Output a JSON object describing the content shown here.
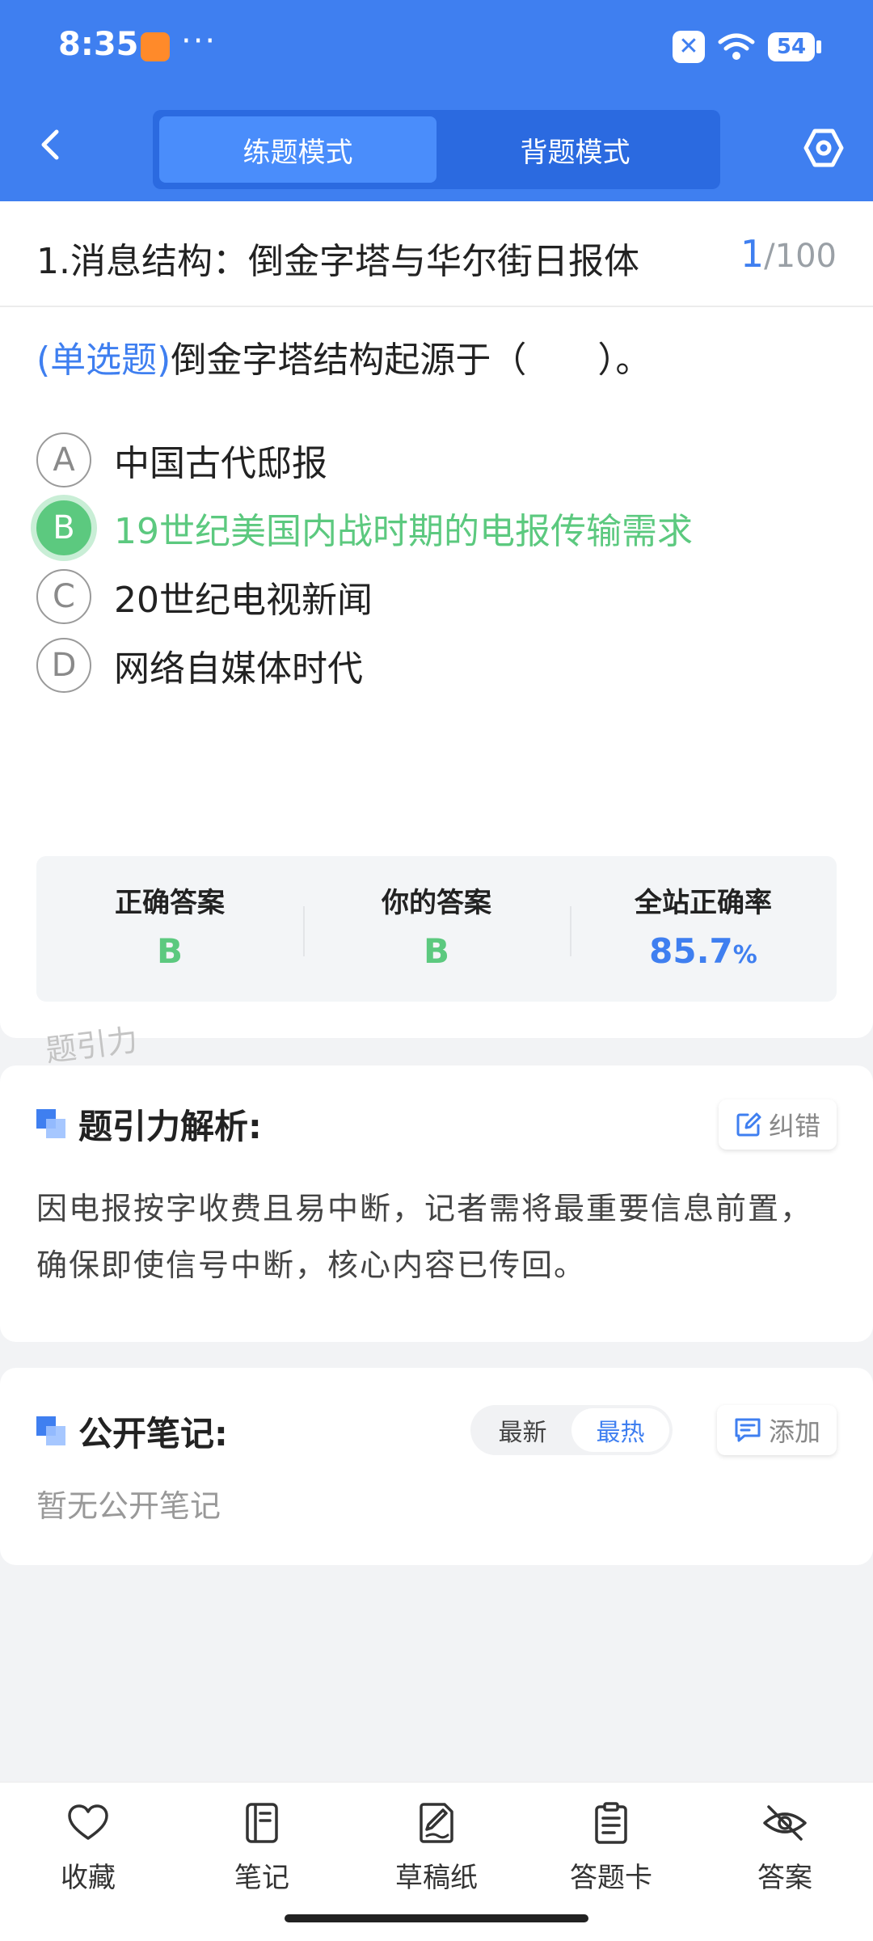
{
  "status_bar": {
    "time": "8:35",
    "more": "···",
    "battery": "54"
  },
  "nav": {
    "tabs": [
      {
        "label": "练题模式",
        "active": true
      },
      {
        "label": "背题模式",
        "active": false
      }
    ],
    "icons": {
      "back": "chevron-left-icon",
      "settings": "hexagon-settings-icon"
    }
  },
  "question": {
    "section_title": "1.消息结构：倒金字塔与华尔街日报体",
    "counter": {
      "current": "1",
      "total": "/100"
    },
    "type_label": "(单选题)",
    "stem": "倒金字塔结构起源于（　　）。",
    "options": [
      {
        "letter": "A",
        "text": "中国古代邸报",
        "state": "normal"
      },
      {
        "letter": "B",
        "text": "19世纪美国内战时期的电报传输需求",
        "state": "correct"
      },
      {
        "letter": "C",
        "text": "20世纪电视新闻",
        "state": "normal"
      },
      {
        "letter": "D",
        "text": "网络自媒体时代",
        "state": "normal"
      }
    ],
    "stats": [
      {
        "label": "正确答案",
        "value": "B"
      },
      {
        "label": "你的答案",
        "value": "B"
      },
      {
        "label": "全站正确率",
        "value": "85.7",
        "unit": "%"
      }
    ]
  },
  "watermark": "题引力",
  "analysis": {
    "title": "题引力解析:",
    "report_label": "纠错",
    "text": "因电报按字收费且易中断，记者需将最重要信息前置，确保即使信号中断，核心内容已传回。"
  },
  "notes": {
    "title": "公开笔记:",
    "sort_tabs": [
      {
        "label": "最新",
        "active": false
      },
      {
        "label": "最热",
        "active": true
      }
    ],
    "add_label": "添加",
    "empty_text": "暂无公开笔记"
  },
  "bottom_bar": [
    {
      "label": "收藏",
      "icon": "heart-icon"
    },
    {
      "label": "笔记",
      "icon": "notebook-icon"
    },
    {
      "label": "草稿纸",
      "icon": "draft-paper-icon"
    },
    {
      "label": "答题卡",
      "icon": "answer-card-icon"
    },
    {
      "label": "答案",
      "icon": "eye-off-icon"
    }
  ],
  "colors": {
    "primary": "#3f7ff0",
    "correct": "#5cc97f",
    "background": "#f2f3f5"
  }
}
